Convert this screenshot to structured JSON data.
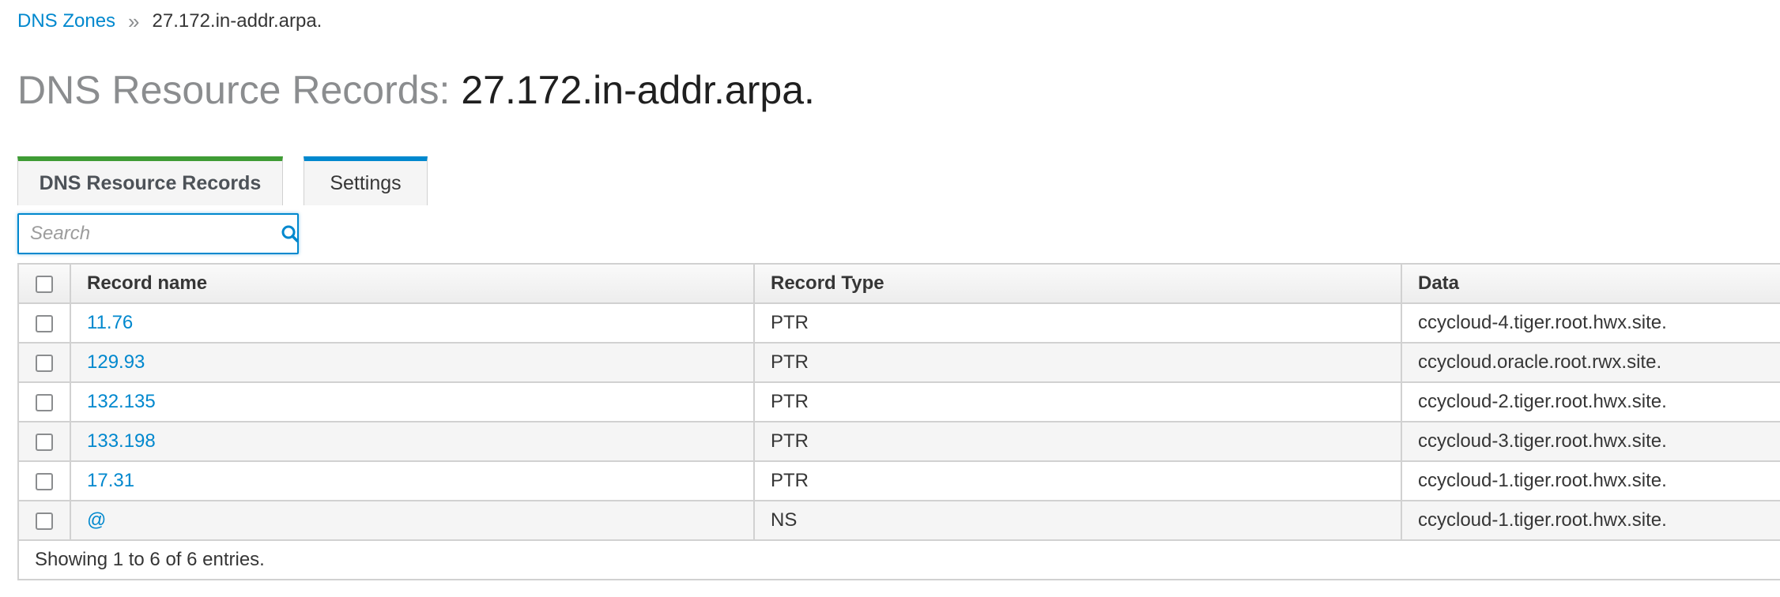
{
  "breadcrumb": {
    "parent": "DNS Zones",
    "separator": "»",
    "current": "27.172.in-addr.arpa."
  },
  "title": {
    "prefix": "DNS Resource Records:",
    "zone": "27.172.in-addr.arpa."
  },
  "tabs": [
    {
      "label": "DNS Resource Records",
      "active": true,
      "accent_color": "#3f9c35"
    },
    {
      "label": "Settings",
      "active": false,
      "accent_color": "#0088ce"
    }
  ],
  "search": {
    "placeholder": "Search",
    "value": "",
    "icon": "search-icon"
  },
  "table": {
    "headers": {
      "name": "Record name",
      "type": "Record Type",
      "data": "Data"
    },
    "rows": [
      {
        "name": "11.76",
        "type": "PTR",
        "data": "ccycloud-4.tiger.root.hwx.site."
      },
      {
        "name": "129.93",
        "type": "PTR",
        "data": "ccycloud.oracle.root.rwx.site."
      },
      {
        "name": "132.135",
        "type": "PTR",
        "data": "ccycloud-2.tiger.root.hwx.site."
      },
      {
        "name": "133.198",
        "type": "PTR",
        "data": "ccycloud-3.tiger.root.hwx.site."
      },
      {
        "name": "17.31",
        "type": "PTR",
        "data": "ccycloud-1.tiger.root.hwx.site."
      },
      {
        "name": "@",
        "type": "NS",
        "data": "ccycloud-1.tiger.root.hwx.site."
      }
    ],
    "footer": "Showing 1 to 6 of 6 entries."
  },
  "colors": {
    "link": "#0088ce",
    "active_tab_accent": "#3f9c35",
    "inactive_tab_accent": "#0088ce"
  }
}
